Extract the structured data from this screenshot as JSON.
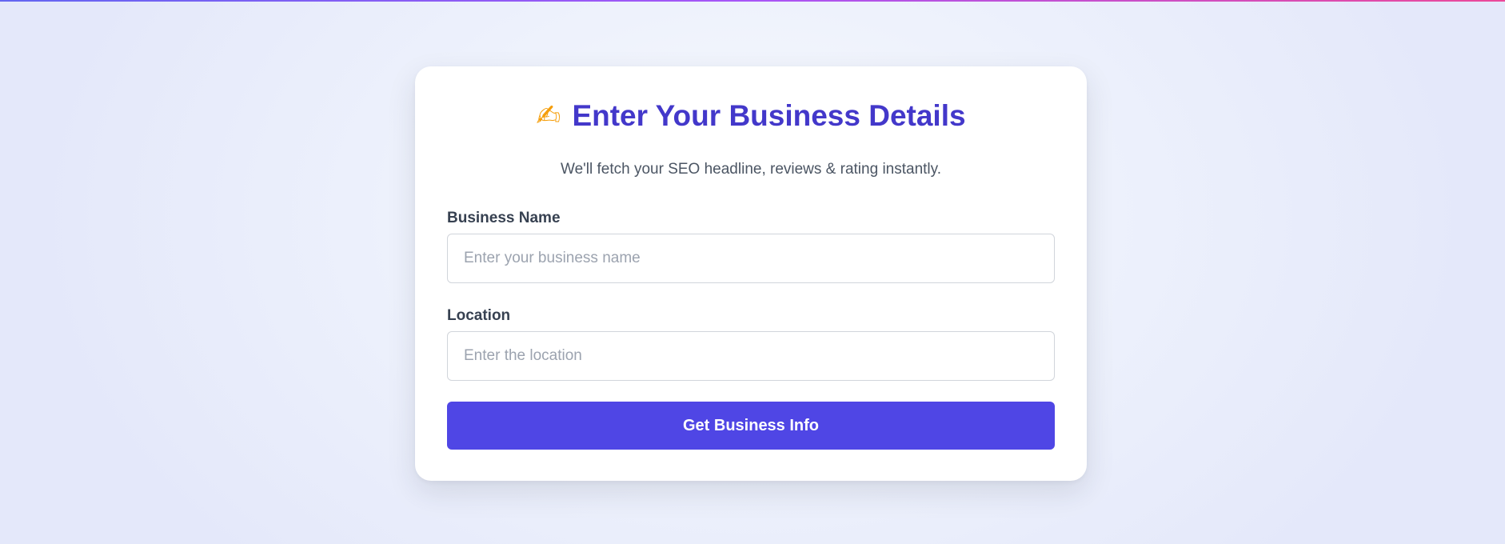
{
  "form": {
    "title_icon": "✍",
    "title_icon_name": "writing-hand-icon",
    "title": "Enter Your Business Details",
    "subtitle": "We'll fetch your SEO headline, reviews & rating instantly.",
    "business_name": {
      "label": "Business Name",
      "value": "",
      "placeholder": "Enter your business name"
    },
    "location": {
      "label": "Location",
      "value": "",
      "placeholder": "Enter the location"
    },
    "submit_label": "Get Business Info"
  },
  "colors": {
    "accent": "#4f46e5",
    "title": "#4338ca",
    "top_bar_gradient": [
      "#6366f1",
      "#a855f7",
      "#ec4899"
    ]
  }
}
